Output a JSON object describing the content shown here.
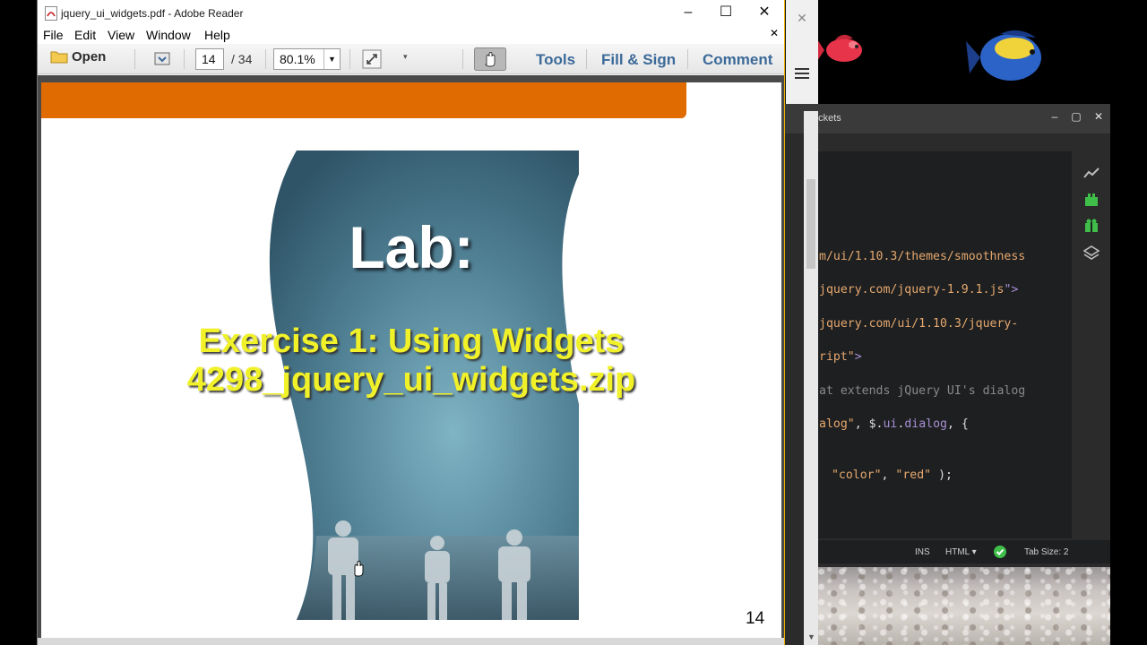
{
  "reader": {
    "window_title": "jquery_ui_widgets.pdf - Adobe Reader",
    "menu": [
      "File",
      "Edit",
      "View",
      "Window",
      "Help"
    ],
    "toolbar": {
      "open_label": "Open",
      "page_current": "14",
      "page_total": "/ 34",
      "zoom": "80.1%",
      "tools_label": "Tools",
      "fill_sign_label": "Fill & Sign",
      "comment_label": "Comment"
    },
    "slide": {
      "title": "Lab:",
      "line1": "Exercise 1: Using Widgets",
      "line2": "4298_jquery_ui_widgets.zip",
      "page_number": "14"
    }
  },
  "brackets": {
    "window_title": "ackets",
    "code_lines": [
      {
        "parts": [
          {
            "t": "m/ui/1.10.3/themes/smoothness",
            "c": "str"
          }
        ]
      },
      {
        "parts": [
          {
            "t": "jquery.com/jquery-1.9.1.js",
            "c": "str"
          },
          {
            "t": "\">",
            "c": "tag"
          }
        ]
      },
      {
        "parts": [
          {
            "t": "jquery.com/ui/1.10.3/jquery-",
            "c": "str"
          }
        ]
      },
      {
        "parts": [
          {
            "t": "ript\"",
            "c": "str"
          },
          {
            "t": ">",
            "c": "tag"
          }
        ]
      },
      {
        "parts": [
          {
            "t": "at extends jQuery UI's dialog",
            "c": "cmt"
          }
        ]
      },
      {
        "parts": [
          {
            "t": "alog\"",
            "c": "str"
          },
          {
            "t": ", $.",
            "c": "plain"
          },
          {
            "t": "ui",
            "c": "ident"
          },
          {
            "t": ".",
            "c": "plain"
          },
          {
            "t": "dialog",
            "c": "ident"
          },
          {
            "t": ", {",
            "c": "plain"
          }
        ]
      },
      {
        "parts": [
          {
            "t": " \"color\"",
            "c": "str"
          },
          {
            "t": ", ",
            "c": "plain"
          },
          {
            "t": "\"red\"",
            "c": "str"
          },
          {
            "t": " );",
            "c": "plain"
          }
        ]
      }
    ],
    "status": {
      "ins": "INS",
      "lang": "HTML",
      "tab_size": "Tab Size: 2"
    }
  }
}
